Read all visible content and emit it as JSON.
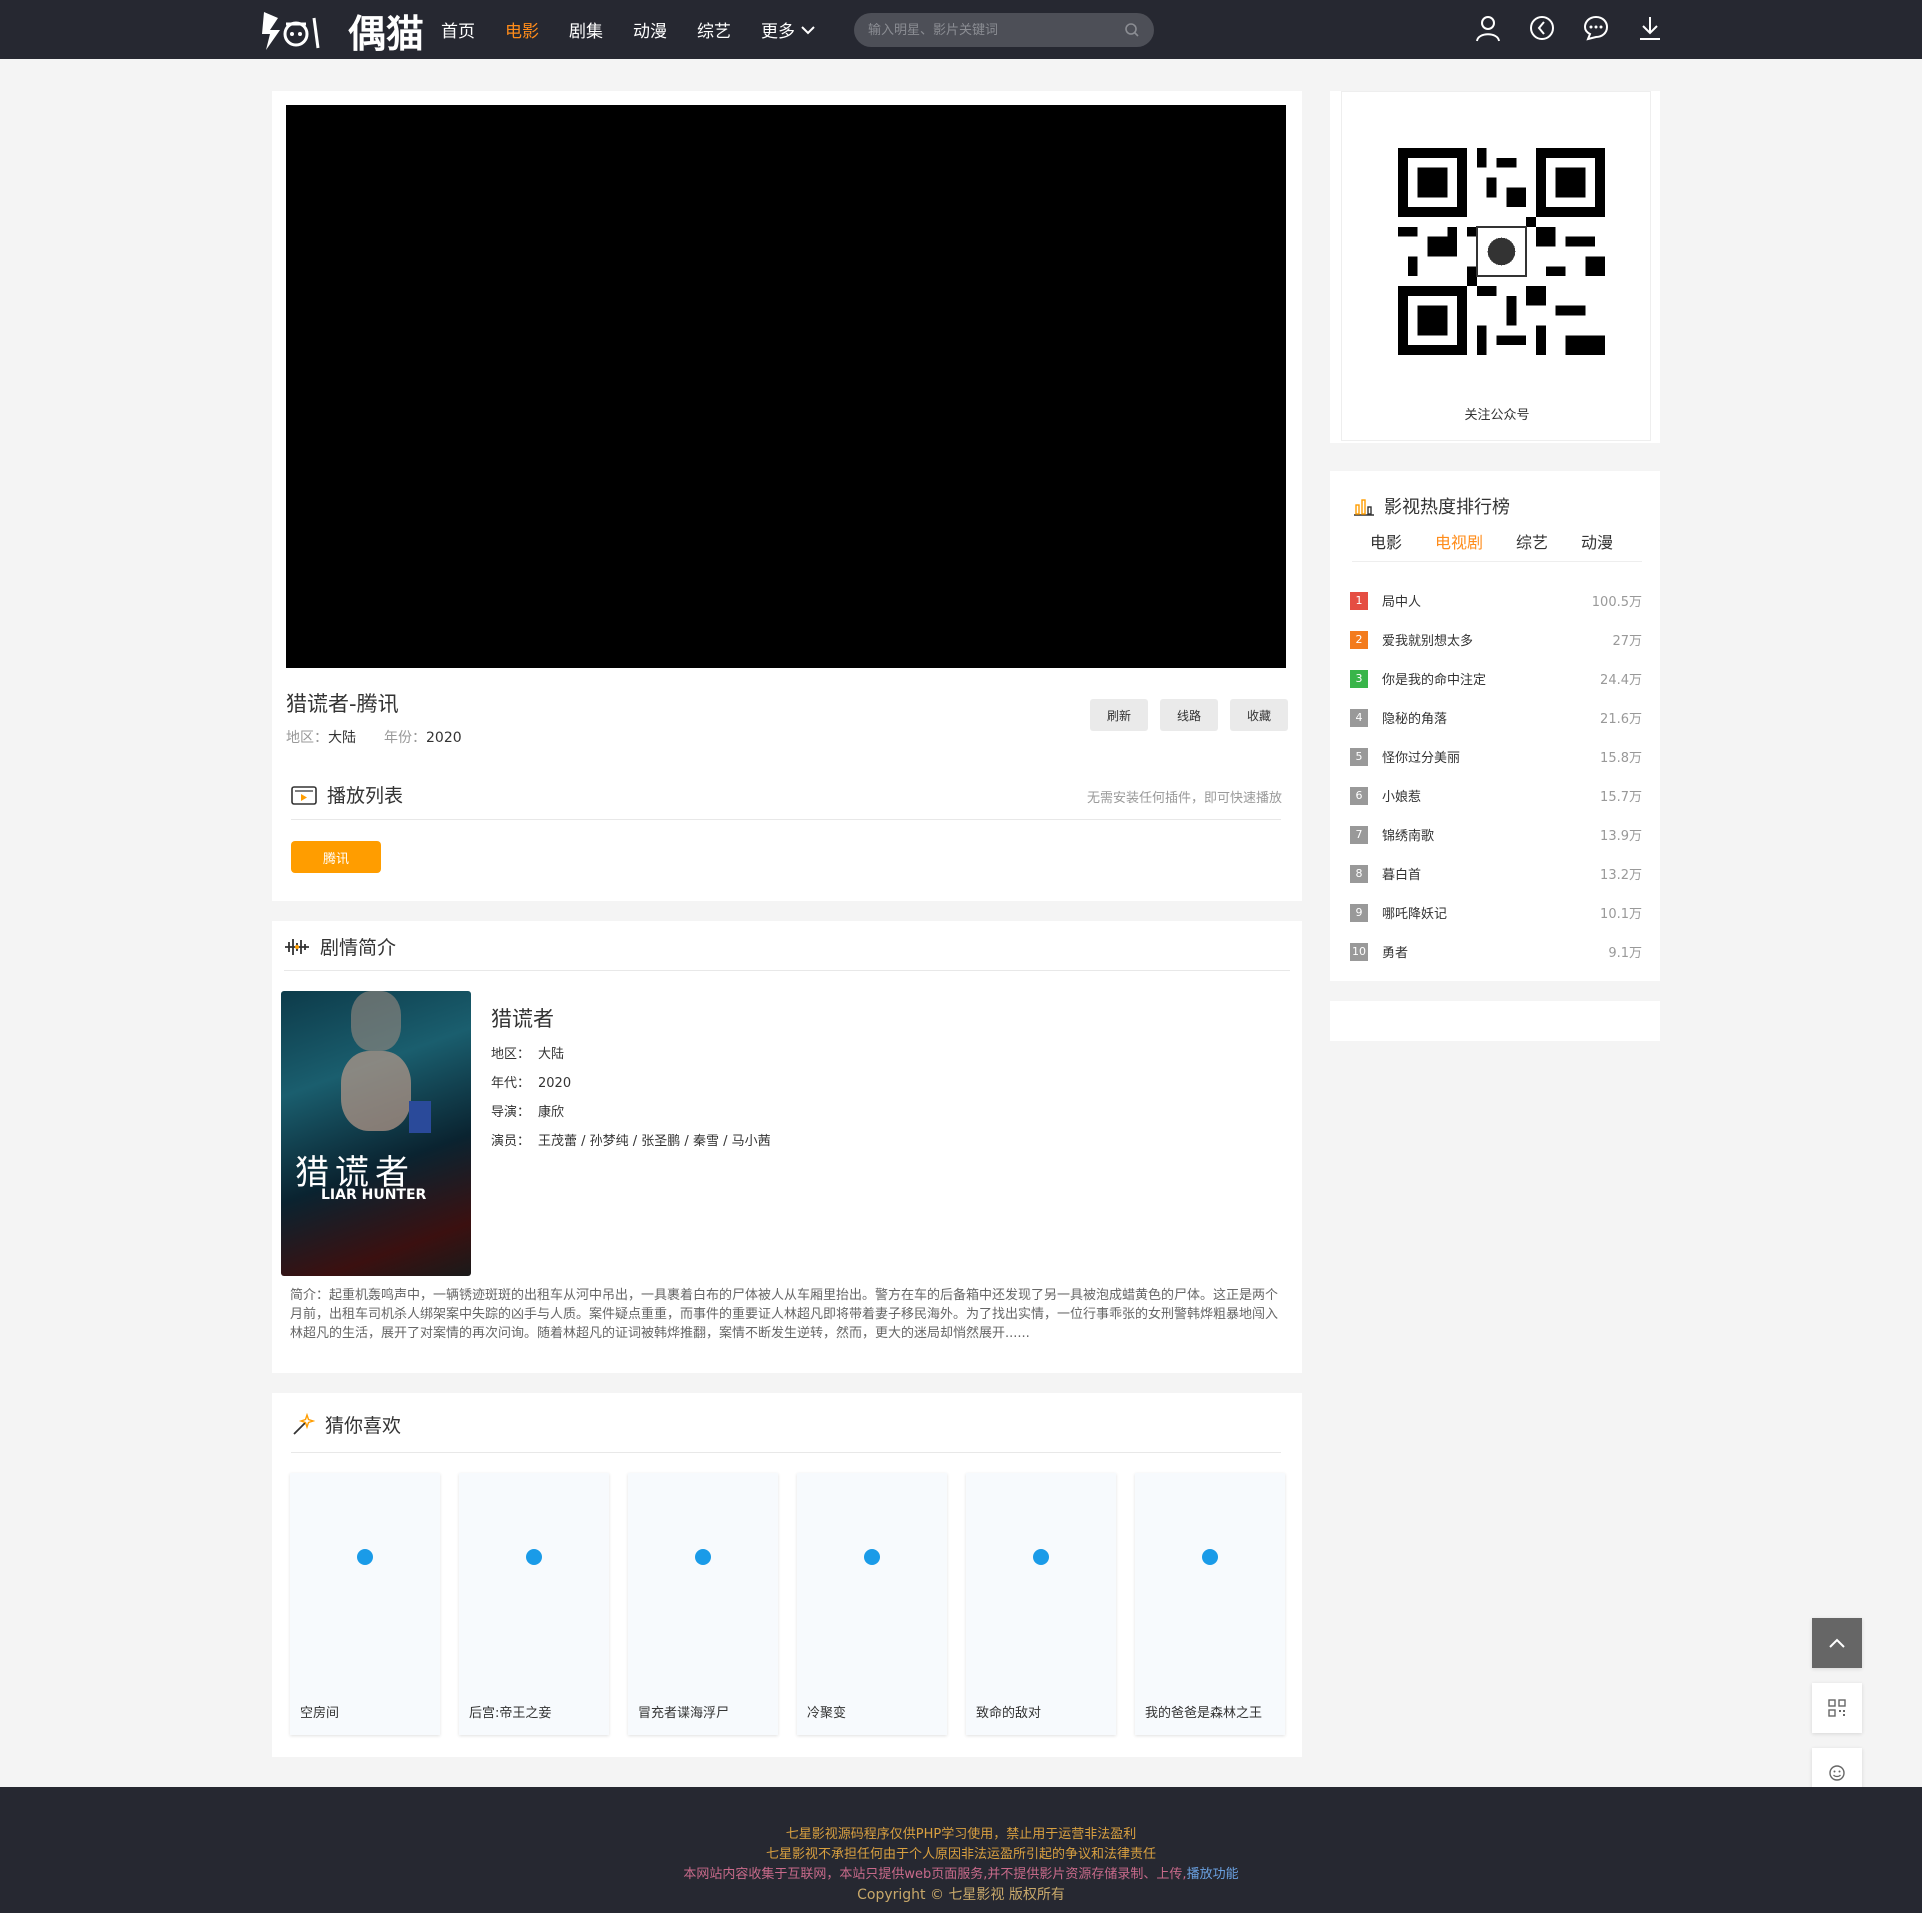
{
  "colors": {
    "header_bg": "#262831",
    "accent": "#ff8c1a",
    "source_btn": "#ff9d00",
    "footer_bg": "#262831"
  },
  "logo": {
    "text": "偶猫"
  },
  "nav": [
    {
      "label": "首页",
      "active": false
    },
    {
      "label": "电影",
      "active": true
    },
    {
      "label": "剧集",
      "active": false
    },
    {
      "label": "动漫",
      "active": false
    },
    {
      "label": "综艺",
      "active": false
    },
    {
      "label": "更多",
      "active": false
    }
  ],
  "search": {
    "placeholder": "输入明星、影片关键词",
    "icon": "search-icon"
  },
  "header_icons": [
    "user-icon",
    "history-icon",
    "message-icon",
    "download-icon"
  ],
  "player": {
    "title": "猎谎者-腾讯",
    "region_label": "地区：",
    "region": "大陆",
    "year_label": "年份：",
    "year": "2020",
    "buttons": [
      "刷新",
      "线路",
      "收藏"
    ]
  },
  "playlist": {
    "title": "播放列表",
    "tip": "无需安装任何插件，即可快速播放",
    "sources": [
      "腾讯"
    ]
  },
  "intro": {
    "title": "剧情简介",
    "poster_title": "猎谎者",
    "poster_sub": "LIAR HUNTER",
    "name": "猎谎者",
    "region_label": "地区：",
    "region": "大陆",
    "year_label": "年代：",
    "year": "2020",
    "director_label": "导演：",
    "director": "康欣",
    "cast_label": "演员：",
    "cast": "王茂蕾 / 孙梦纯 / 张圣鹏 / 秦雪 / 马小茜",
    "desc": "简介：起重机轰鸣声中，一辆锈迹斑斑的出租车从河中吊出，一具裹着白布的尸体被人从车厢里抬出。警方在车的后备箱中还发现了另一具被泡成蜡黄色的尸体。这正是两个月前，出租车司机杀人绑架案中失踪的凶手与人质。案件疑点重重，而事件的重要证人林超凡即将带着妻子移民海外。为了找出实情，一位行事乖张的女刑警韩烨粗暴地闯入林超凡的生活，展开了对案情的再次问询。随着林超凡的证词被韩烨推翻，案情不断发生逆转，然而，更大的迷局却悄然展开......"
  },
  "guess": {
    "title": "猜你喜欢",
    "items": [
      "空房间",
      "后宫:帝王之妾",
      "冒充者谍海浮尸",
      "冷聚变",
      "致命的敌对",
      "我的爸爸是森林之王"
    ]
  },
  "qr": {
    "label": "关注公众号"
  },
  "rank": {
    "title": "影视热度排行榜",
    "tabs": [
      "电影",
      "电视剧",
      "综艺",
      "动漫"
    ],
    "active_tab": "电视剧",
    "items": [
      {
        "num": "1",
        "name": "局中人",
        "value": "100.5万",
        "color": "#e54d42"
      },
      {
        "num": "2",
        "name": "爱我就别想太多",
        "value": "27万",
        "color": "#f37b1d"
      },
      {
        "num": "3",
        "name": "你是我的命中注定",
        "value": "24.4万",
        "color": "#39b54a"
      },
      {
        "num": "4",
        "name": "隐秘的角落",
        "value": "21.6万",
        "color": "#999999"
      },
      {
        "num": "5",
        "name": "怪你过分美丽",
        "value": "15.8万",
        "color": "#999999"
      },
      {
        "num": "6",
        "name": "小娘惹",
        "value": "15.7万",
        "color": "#999999"
      },
      {
        "num": "7",
        "name": "锦绣南歌",
        "value": "13.9万",
        "color": "#999999"
      },
      {
        "num": "8",
        "name": "暮白首",
        "value": "13.2万",
        "color": "#999999"
      },
      {
        "num": "9",
        "name": "哪吒降妖记",
        "value": "10.1万",
        "color": "#999999"
      },
      {
        "num": "10",
        "name": "勇者",
        "value": "9.1万",
        "color": "#999999"
      }
    ]
  },
  "footer": {
    "line1": "七星影视源码程序仅供PHP学习使用，禁止用于运营非法盈利",
    "line2": "七星影视不承担任何由于个人原因非法运盈所引起的争议和法律责任",
    "line3": "本网站内容收集于互联网，本站只提供web页面服务,并不提供影片资源存储录制、上传,",
    "line3_link": "播放功能",
    "line4": "Copyright ©  七星影视 版权所有"
  }
}
